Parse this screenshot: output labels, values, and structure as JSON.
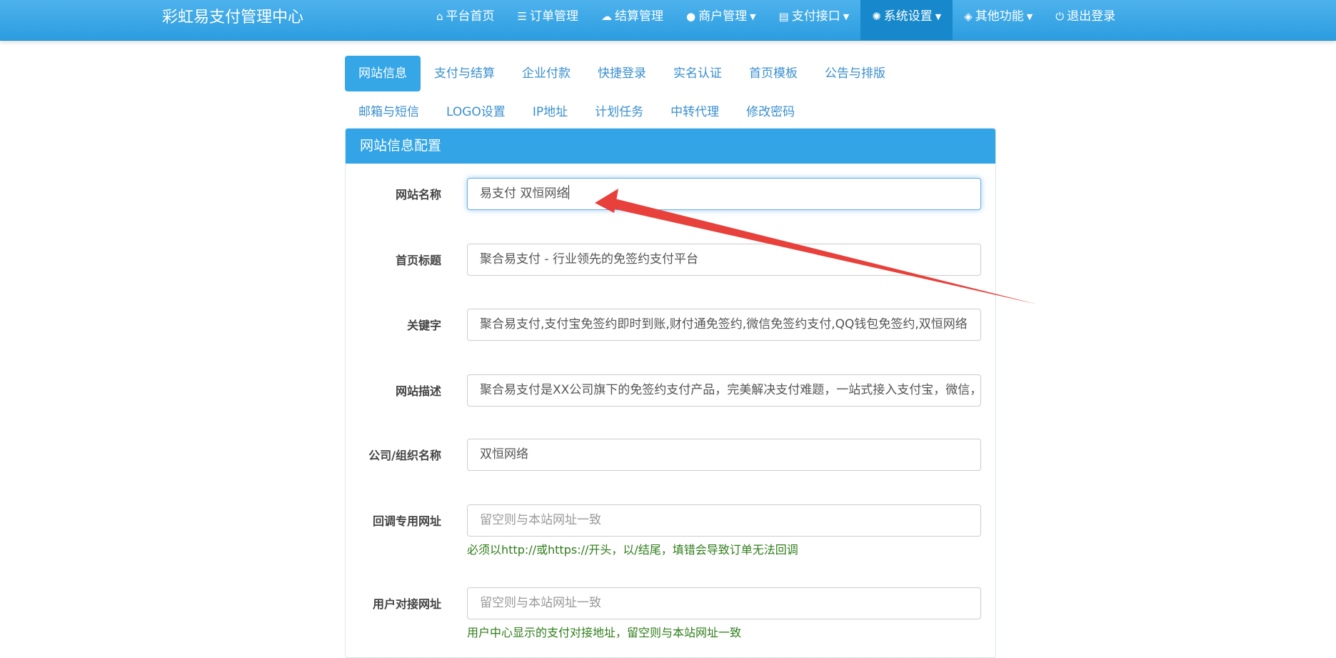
{
  "navbar": {
    "brand": "彩虹易支付管理中心",
    "items": [
      {
        "label": "平台首页",
        "icon": "home-icon",
        "glyph": "⌂",
        "dropdown": false,
        "active": false
      },
      {
        "label": "订单管理",
        "icon": "list-icon",
        "glyph": "☰",
        "dropdown": false,
        "active": false
      },
      {
        "label": "结算管理",
        "icon": "cloud-icon",
        "glyph": "☁",
        "dropdown": false,
        "active": false
      },
      {
        "label": "商户管理",
        "icon": "user-icon",
        "glyph": "●",
        "dropdown": true,
        "active": false
      },
      {
        "label": "支付接口",
        "icon": "credit-card-icon",
        "glyph": "▤",
        "dropdown": true,
        "active": false
      },
      {
        "label": "系统设置",
        "icon": "gear-icon",
        "glyph": "✺",
        "dropdown": true,
        "active": true
      },
      {
        "label": "其他功能",
        "icon": "cube-icon",
        "glyph": "◈",
        "dropdown": true,
        "active": false
      },
      {
        "label": "退出登录",
        "icon": "power-icon",
        "glyph": "⏻",
        "dropdown": false,
        "active": false
      }
    ]
  },
  "tabs": [
    "网站信息",
    "支付与结算",
    "企业付款",
    "快捷登录",
    "实名认证",
    "首页模板",
    "公告与排版",
    "邮箱与短信",
    "LOGO设置",
    "IP地址",
    "计划任务",
    "中转代理",
    "修改密码"
  ],
  "active_tab": "网站信息",
  "panel": {
    "title": "网站信息配置",
    "fields": [
      {
        "label": "网站名称",
        "value": "易支付 双恒网络",
        "placeholder": "",
        "focused": true,
        "help": ""
      },
      {
        "label": "首页标题",
        "value": "聚合易支付 - 行业领先的免签约支付平台",
        "placeholder": "",
        "help": ""
      },
      {
        "label": "关键字",
        "value": "聚合易支付,支付宝免签约即时到账,财付通免签约,微信免签约支付,QQ钱包免签约,双恒网络",
        "placeholder": "",
        "help": ""
      },
      {
        "label": "网站描述",
        "value": "聚合易支付是XX公司旗下的免签约支付产品，完美解决支付难题，一站式接入支付宝，微信，财付通，QQ钱包",
        "placeholder": "",
        "help": ""
      },
      {
        "label": "公司/组织名称",
        "value": "双恒网络",
        "placeholder": "",
        "help": ""
      },
      {
        "label": "回调专用网址",
        "value": "",
        "placeholder": "留空则与本站网址一致",
        "help": "必须以http://或https://开头，以/结尾，填错会导致订单无法回调"
      },
      {
        "label": "用户对接网址",
        "value": "",
        "placeholder": "留空则与本站网址一致",
        "help": "用户中心显示的支付对接地址，留空则与本站网址一致"
      }
    ]
  },
  "colors": {
    "navbar": "#2c9de0",
    "nav_active": "#1788cb",
    "accent": "#33a5e6",
    "help_text": "#2f7d1a",
    "annotation_arrow": "#e8403a"
  }
}
